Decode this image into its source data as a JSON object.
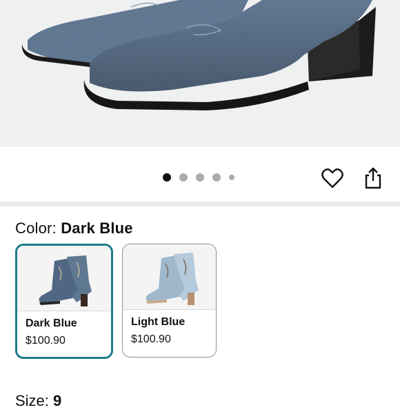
{
  "product": {
    "image_alt": "Dark blue denim western ankle boots",
    "carousel": {
      "total": 5,
      "active": 1
    },
    "favorite_icon": "heart-icon",
    "share_icon": "share-icon"
  },
  "color_selector": {
    "label": "Color:",
    "selected": "Dark Blue",
    "options": [
      {
        "name": "Dark Blue",
        "price": "$100.90",
        "selected": true
      },
      {
        "name": "Light Blue",
        "price": "$100.90",
        "selected": false
      }
    ]
  },
  "size_selector": {
    "label": "Size:",
    "selected": "9"
  },
  "colors": {
    "selected_border": "#1b7c8a",
    "dark_denim": "#5f7892",
    "light_denim": "#a9c2d6"
  }
}
